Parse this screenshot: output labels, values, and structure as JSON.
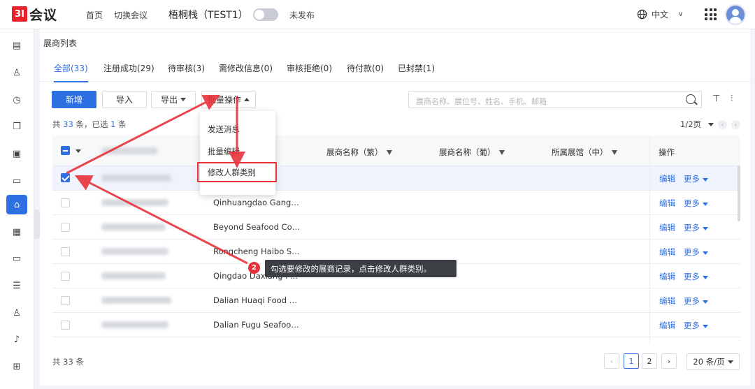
{
  "header": {
    "logo_mark": "3I",
    "logo_text": "会议",
    "home": "首页",
    "switch": "切换会议",
    "event_name": "梧桐栈（TEST1）",
    "publish_status": "未发布",
    "language": "中文"
  },
  "page": {
    "title": "展商列表"
  },
  "tabs": [
    {
      "label": "全部(33)"
    },
    {
      "label": "注册成功(29)"
    },
    {
      "label": "待审核(3)"
    },
    {
      "label": "需修改信息(0)"
    },
    {
      "label": "审核拒绝(0)"
    },
    {
      "label": "待付款(0)"
    },
    {
      "label": "已封禁(1)"
    }
  ],
  "toolbar": {
    "add": "新增",
    "import": "导入",
    "export": "导出",
    "batch": "批量操作",
    "search_placeholder": "展商名称、展位号、姓名、手机、邮箱"
  },
  "summary": {
    "prefix": "共",
    "total": "33",
    "mid": "条，已选",
    "selected": "1",
    "suffix": "条"
  },
  "pager_top": "1/2页",
  "table": {
    "headers": [
      "展商名称（繁）",
      "展商名称（葡）",
      "所属展馆（中）",
      "操作"
    ],
    "rows": [
      {
        "name": "",
        "selected": true
      },
      {
        "name": "Qinhuangdao Gang…",
        "selected": false
      },
      {
        "name": "Beyond Seafood Co…",
        "selected": false
      },
      {
        "name": "Rongcheng Haibo S…",
        "selected": false
      },
      {
        "name": "Qingdao Daxiang F…",
        "selected": false
      },
      {
        "name": "Dalian Huaqi Food …",
        "selected": false
      },
      {
        "name": "Dalian Fugu Seafoo…",
        "selected": false
      }
    ],
    "edit_label": "编辑",
    "more_label": "更多"
  },
  "dropdown": {
    "items": [
      "发送消息",
      "批量编辑",
      "修改人群类别"
    ]
  },
  "tooltip": {
    "badge": "2",
    "text": "勾选要修改的展商记录，点击修改人群类别。"
  },
  "footer": {
    "total": "共 33 条",
    "pages": [
      "1",
      "2"
    ],
    "page_size": "20 条/页"
  },
  "colors": {
    "accent": "#2f6fe4",
    "annotation": "#e8323b"
  }
}
